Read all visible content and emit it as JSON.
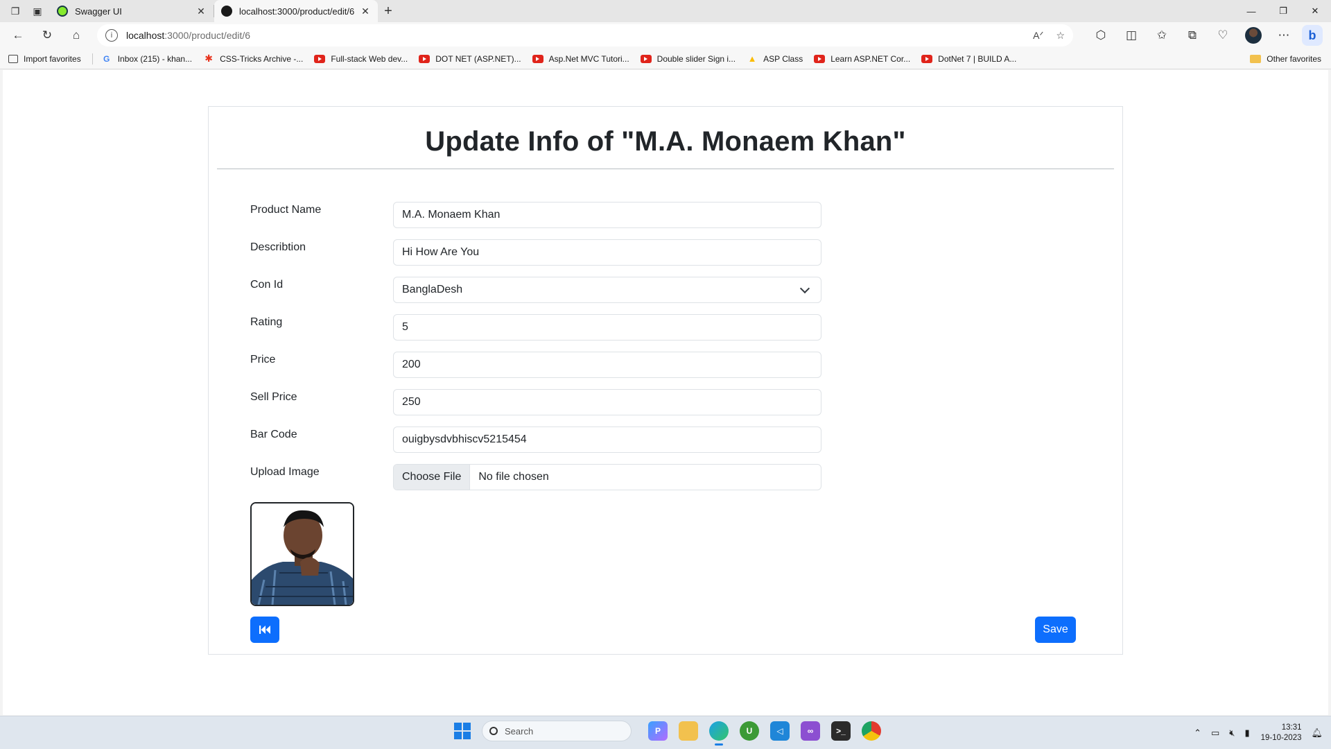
{
  "browser": {
    "tabs": [
      {
        "title": "Swagger UI",
        "active": false,
        "favicon_color": "#85ea2d"
      },
      {
        "title": "localhost:3000/product/edit/6",
        "active": true,
        "favicon_color": "#1a1a1a"
      }
    ],
    "url_host": "localhost",
    "url_rest": ":3000/product/edit/6",
    "favorites": [
      {
        "label": "Import favorites",
        "icon": "import-icon"
      },
      {
        "label": "Inbox (215) - khan...",
        "icon": "google-icon"
      },
      {
        "label": "CSS-Tricks Archive -...",
        "icon": "css-tricks-icon"
      },
      {
        "label": "Full-stack Web dev...",
        "icon": "youtube-icon"
      },
      {
        "label": "DOT NET (ASP.NET)...",
        "icon": "youtube-icon"
      },
      {
        "label": "Asp.Net MVC Tutori...",
        "icon": "youtube-icon"
      },
      {
        "label": "Double slider Sign i...",
        "icon": "youtube-icon"
      },
      {
        "label": "ASP Class",
        "icon": "google-drive-icon"
      },
      {
        "label": "Learn ASP.NET Cor...",
        "icon": "youtube-icon"
      },
      {
        "label": "DotNet 7 | BUILD A...",
        "icon": "youtube-icon"
      }
    ],
    "other_favorites": "Other favorites"
  },
  "page": {
    "title": "Update Info of \"M.A. Monaem Khan\"",
    "fields": {
      "product_name": {
        "label": "Product Name",
        "value": "M.A. Monaem Khan"
      },
      "description": {
        "label": "Describtion",
        "value": "Hi How Are You"
      },
      "con_id": {
        "label": "Con Id",
        "value": "BanglaDesh"
      },
      "rating": {
        "label": "Rating",
        "value": "5"
      },
      "price": {
        "label": "Price",
        "value": "200"
      },
      "sell_price": {
        "label": "Sell Price",
        "value": "250"
      },
      "bar_code": {
        "label": "Bar Code",
        "value": "ouigbysdvbhiscv5215454"
      },
      "upload_image": {
        "label": "Upload Image",
        "button": "Choose File",
        "status": "No file chosen"
      }
    },
    "save_label": "Save",
    "back_icon": "fast-backward-icon",
    "accent_color": "#0d6efd"
  },
  "taskbar": {
    "search_placeholder": "Search",
    "time": "13:31",
    "date": "19-10-2023"
  }
}
